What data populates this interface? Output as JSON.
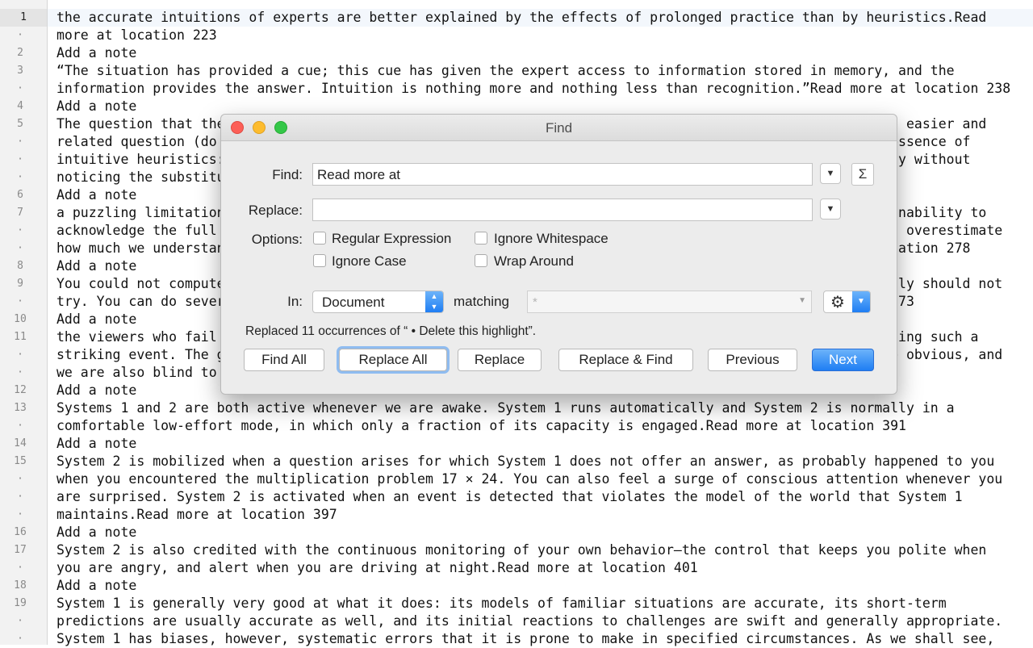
{
  "editor": {
    "current_line": "1",
    "lines": [
      {
        "num": "1",
        "text": "the accurate intuitions of experts are better explained by the effects of prolonged practice than by heuristics.Read"
      },
      {
        "num": "·",
        "text": "more at location 223"
      },
      {
        "num": "2",
        "text": "Add a note"
      },
      {
        "num": "3",
        "text": "“The situation has provided a cue; this cue has given the expert access to information stored in memory, and the"
      },
      {
        "num": "·",
        "text": "information provides the answer. Intuition is nothing more and nothing less than recognition.”Read more at location 238"
      },
      {
        "num": "4",
        "text": "Add a note"
      },
      {
        "num": "5",
        "text": "The question that the                                                                                  an easier and"
      },
      {
        "num": "·",
        "text": "related question (do                                                                                    essence of"
      },
      {
        "num": "·",
        "text": "intuitive heuristics:                                                                                   ly without"
      },
      {
        "num": "·",
        "text": "noticing the substitu"
      },
      {
        "num": "6",
        "text": "Add a note"
      },
      {
        "num": "7",
        "text": "a puzzling limitation                                                                                   inability to"
      },
      {
        "num": "·",
        "text": "acknowledge the full                                                                                    o overestimate"
      },
      {
        "num": "·",
        "text": "how much we understan                                                                                   cation 278"
      },
      {
        "num": "8",
        "text": "Add a note"
      },
      {
        "num": "9",
        "text": "You could not compute                                                                                   nly should not"
      },
      {
        "num": "·",
        "text": "try. You can do sever                                                                                   373"
      },
      {
        "num": "10",
        "text": "Add a note"
      },
      {
        "num": "11",
        "text": "the viewers who fail                                                                                    sing such a"
      },
      {
        "num": "·",
        "text": "striking event. The g                                                                                   e obvious, and"
      },
      {
        "num": "·",
        "text": "we are also blind to"
      },
      {
        "num": "12",
        "text": "Add a note"
      },
      {
        "num": "13",
        "text": "Systems 1 and 2 are both active whenever we are awake. System 1 runs automatically and System 2 is normally in a"
      },
      {
        "num": "·",
        "text": "comfortable low-effort mode, in which only a fraction of its capacity is engaged.Read more at location 391"
      },
      {
        "num": "14",
        "text": "Add a note"
      },
      {
        "num": "15",
        "text": "System 2 is mobilized when a question arises for which System 1 does not offer an answer, as probably happened to you"
      },
      {
        "num": "·",
        "text": "when you encountered the multiplication problem 17 × 24. You can also feel a surge of conscious attention whenever you"
      },
      {
        "num": "·",
        "text": "are surprised. System 2 is activated when an event is detected that violates the model of the world that System 1"
      },
      {
        "num": "·",
        "text": "maintains.Read more at location 397"
      },
      {
        "num": "16",
        "text": "Add a note"
      },
      {
        "num": "17",
        "text": "System 2 is also credited with the continuous monitoring of your own behavior—the control that keeps you polite when"
      },
      {
        "num": "·",
        "text": "you are angry, and alert when you are driving at night.Read more at location 401"
      },
      {
        "num": "18",
        "text": "Add a note"
      },
      {
        "num": "19",
        "text": "System 1 is generally very good at what it does: its models of familiar situations are accurate, its short-term"
      },
      {
        "num": "·",
        "text": "predictions are usually accurate as well, and its initial reactions to challenges are swift and generally appropriate."
      },
      {
        "num": "·",
        "text": "System 1 has biases, however, systematic errors that it is prone to make in specified circumstances. As we shall see,"
      }
    ]
  },
  "find_dialog": {
    "title": "Find",
    "find_label": "Find:",
    "find_value": "Read more at",
    "sigma_glyph": "Σ",
    "replace_label": "Replace:",
    "replace_value": "",
    "options_label": "Options:",
    "options": {
      "regex": "Regular Expression",
      "ignore_whitespace": "Ignore Whitespace",
      "ignore_case": "Ignore Case",
      "wrap_around": "Wrap Around"
    },
    "in_label": "In:",
    "in_value": "Document",
    "matching_label": "matching",
    "matching_value": "*",
    "status": "Replaced 11 occurrences of “  • Delete this highlight”.",
    "buttons": {
      "find_all": "Find All",
      "replace_all": "Replace All",
      "replace": "Replace",
      "replace_find": "Replace & Find",
      "previous": "Previous",
      "next": "Next"
    },
    "colors": {
      "close": "#fc5f57",
      "minimize": "#fdbc2e",
      "zoom": "#34c748",
      "accent": "#1f7ef3"
    }
  }
}
